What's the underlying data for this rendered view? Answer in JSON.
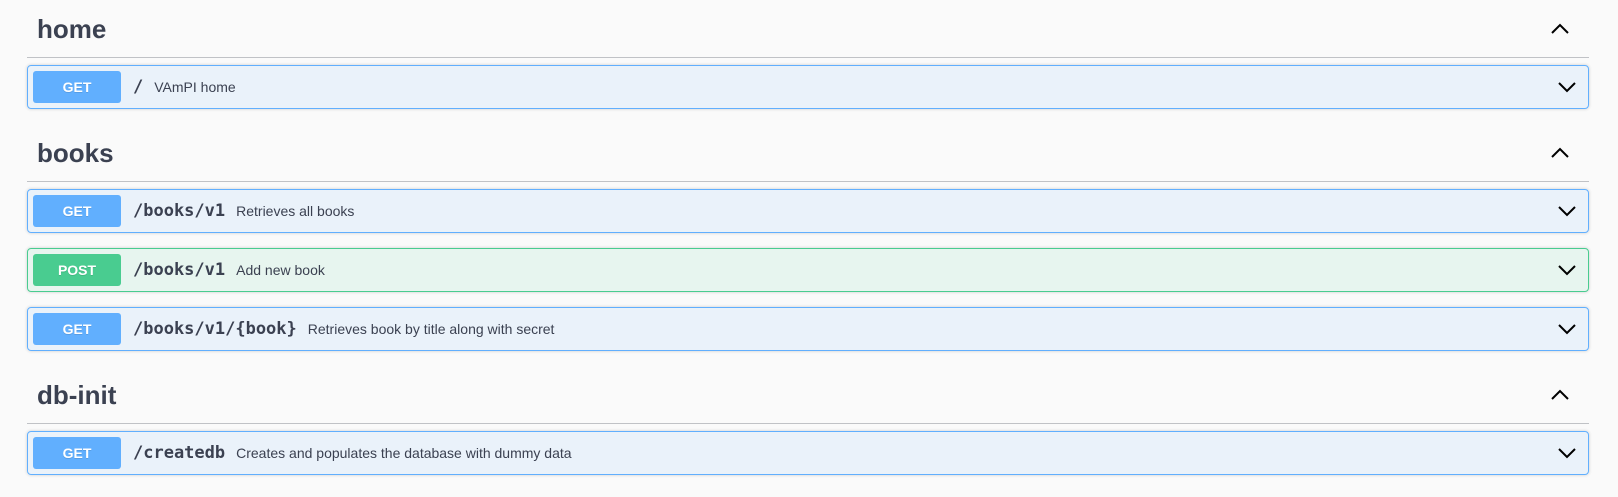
{
  "colors": {
    "get": "#61affe",
    "post": "#49cc90",
    "text": "#3b4151",
    "background": "#fafafa"
  },
  "sections": [
    {
      "title": "home",
      "toggle_icon": "chevron-up-icon",
      "operations": [
        {
          "method": "GET",
          "path": "/",
          "summary": "VAmPI home",
          "toggle_icon": "chevron-down-icon"
        }
      ]
    },
    {
      "title": "books",
      "toggle_icon": "chevron-up-icon",
      "operations": [
        {
          "method": "GET",
          "path": "/books/v1",
          "summary": "Retrieves all books",
          "toggle_icon": "chevron-down-icon"
        },
        {
          "method": "POST",
          "path": "/books/v1",
          "summary": "Add new book",
          "toggle_icon": "chevron-down-icon"
        },
        {
          "method": "GET",
          "path": "/books/v1/{book}",
          "summary": "Retrieves book by title along with secret",
          "toggle_icon": "chevron-down-icon"
        }
      ]
    },
    {
      "title": "db-init",
      "toggle_icon": "chevron-up-icon",
      "operations": [
        {
          "method": "GET",
          "path": "/createdb",
          "summary": "Creates and populates the database with dummy data",
          "toggle_icon": "chevron-down-icon"
        }
      ]
    }
  ]
}
